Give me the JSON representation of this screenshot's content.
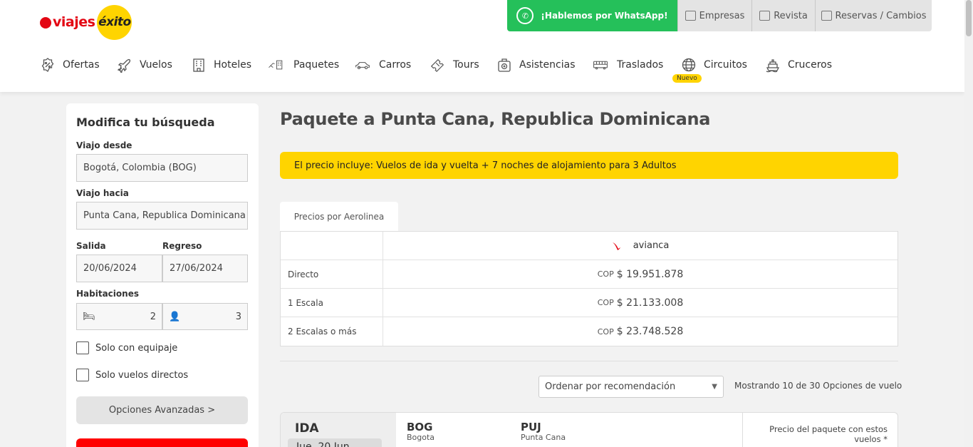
{
  "header": {
    "logo": {
      "part1": "viajes",
      "part2": "éxito"
    },
    "whatsapp_label": "¡Hablemos por WhatsApp!",
    "top_links": [
      {
        "label": "Empresas",
        "icon": "briefcase-icon"
      },
      {
        "label": "Revista",
        "icon": "magazine-icon"
      },
      {
        "label": "Reservas / Cambios",
        "icon": "luggage-cart-icon"
      }
    ],
    "nav": [
      {
        "label": "Ofertas",
        "icon": "discount-badge-icon"
      },
      {
        "label": "Vuelos",
        "icon": "airplane-icon"
      },
      {
        "label": "Hoteles",
        "icon": "building-icon"
      },
      {
        "label": "Paquetes",
        "icon": "plane-building-icon"
      },
      {
        "label": "Carros",
        "icon": "car-icon"
      },
      {
        "label": "Tours",
        "icon": "ticket-icon"
      },
      {
        "label": "Asistencias",
        "icon": "medical-bag-icon"
      },
      {
        "label": "Traslados",
        "icon": "bus-icon"
      },
      {
        "label": "Circuitos",
        "icon": "globe-icon"
      },
      {
        "label": "Cruceros",
        "icon": "ship-icon"
      }
    ],
    "nuevo_badge": "Nuevo"
  },
  "sidebar": {
    "title": "Modifica tu búsqueda",
    "from_label": "Viajo desde",
    "from_value": "Bogotá, Colombia (BOG)",
    "to_label": "Viajo hacia",
    "to_value": "Punta Cana, Republica Dominicana",
    "departure_label": "Salida",
    "departure_value": "20/06/2024",
    "return_label": "Regreso",
    "return_value": "27/06/2024",
    "rooms_label": "Habitaciones",
    "rooms_value": "2",
    "people_value": "3",
    "check_baggage": "Solo con equipaje",
    "check_direct": "Solo vuelos directos",
    "advanced_button": "Opciones Avanzadas >"
  },
  "main": {
    "title": "Paquete a Punta Cana, Republica Dominicana",
    "banner": "El precio incluye: Vuelos de ida y vuelta + 7 noches de alojamiento para 3 Adultos",
    "tab_label": "Precios por Aerolinea",
    "airline": "avianca",
    "currency": "COP",
    "fares": [
      {
        "label": "Directo",
        "price": "$ 19.951.878"
      },
      {
        "label": "1 Escala",
        "price": "$ 21.133.008"
      },
      {
        "label": "2 Escalas o más",
        "price": "$ 23.748.528"
      }
    ],
    "sort_value": "Ordenar por recomendación",
    "showing_text": "Mostrando 10 de 30 Opciones de vuelo",
    "flight": {
      "direction": "IDA",
      "date": "Jue. 20 Jun.",
      "origin_code": "BOG",
      "origin_city": "Bogota",
      "dest_code": "PUJ",
      "dest_city": "Punta Cana",
      "price_label": "Precio del paquete con estos vuelos *"
    }
  },
  "colors": {
    "brand_red": "#e30613",
    "brand_yellow": "#ffd400",
    "whatsapp_green": "#25c05a"
  }
}
